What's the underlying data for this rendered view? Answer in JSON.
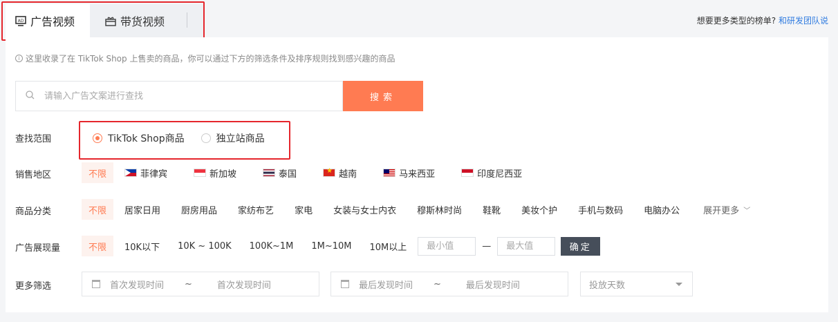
{
  "tabs": [
    {
      "label": "广告视频",
      "icon": "ad-video-icon",
      "active": true
    },
    {
      "label": "带货视频",
      "icon": "gift-icon",
      "active": false
    }
  ],
  "top_right": {
    "text": "想要更多类型的榜单?",
    "link": "和研发团队说"
  },
  "notice": "这里收录了在 TikTok Shop 上售卖的商品，你可以通过下方的筛选条件及排序规则找到感兴趣的商品",
  "search": {
    "placeholder": "请输入广告文案进行查找",
    "button": "搜索"
  },
  "scope": {
    "label": "查找范围",
    "options": [
      {
        "label": "TikTok Shop商品",
        "checked": true
      },
      {
        "label": "独立站商品",
        "checked": false
      }
    ]
  },
  "region": {
    "label": "销售地区",
    "options": [
      {
        "label": "不限",
        "active": true
      },
      {
        "label": "菲律宾",
        "flag": "ph"
      },
      {
        "label": "新加坡",
        "flag": "sg"
      },
      {
        "label": "泰国",
        "flag": "th"
      },
      {
        "label": "越南",
        "flag": "vn"
      },
      {
        "label": "马来西亚",
        "flag": "my"
      },
      {
        "label": "印度尼西亚",
        "flag": "id"
      }
    ]
  },
  "category": {
    "label": "商品分类",
    "options": [
      "不限",
      "居家日用",
      "厨房用品",
      "家纺布艺",
      "家电",
      "女装与女士内衣",
      "穆斯林时尚",
      "鞋靴",
      "美妆个护",
      "手机与数码",
      "电脑办公"
    ],
    "expand": "展开更多"
  },
  "impressions": {
    "label": "广告展现量",
    "options": [
      "不限",
      "10K以下",
      "10K ~ 100K",
      "100K~1M",
      "1M~10M",
      "10M以上"
    ],
    "min_placeholder": "最小值",
    "max_placeholder": "最大值",
    "dash": "—",
    "confirm": "确定"
  },
  "more": {
    "label": "更多筛选",
    "first_seen": {
      "start": "首次发现时间",
      "sep": "~",
      "end": "首次发现时间"
    },
    "last_seen": {
      "start": "最后发现时间",
      "sep": "~",
      "end": "最后发现时间"
    },
    "days_placeholder": "投放天数"
  },
  "colors": {
    "accent": "#ff7b52",
    "annotation_red": "#e5262c",
    "confirm_dark": "#464e5a",
    "link": "#2f7be0"
  }
}
